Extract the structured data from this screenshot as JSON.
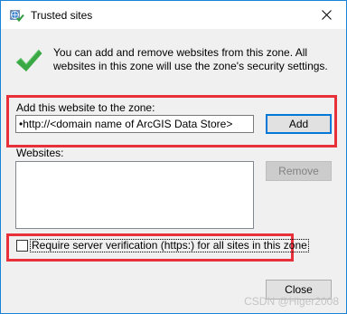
{
  "window": {
    "title": "Trusted sites",
    "title_icon": "globe-check-icon",
    "close_icon": "close-icon"
  },
  "info": {
    "icon": "green-checkmark-icon",
    "text": "You can add and remove websites from this zone. All websites in this zone will use the zone's security settings."
  },
  "add_site": {
    "label": "Add this website to the zone:",
    "input_value": "•http://<domain name of ArcGIS Data Store>",
    "add_button": "Add"
  },
  "websites": {
    "label": "Websites:",
    "items": [],
    "remove_button": "Remove"
  },
  "verification": {
    "label": "Require server verification (https:) for all sites in this zone",
    "checked": false
  },
  "footer": {
    "close_button": "Close",
    "watermark": "CSDN @Higer2008"
  },
  "colors": {
    "highlight": "#e8303b",
    "check_green": "#3aa845",
    "window_border": "#1883d7"
  }
}
